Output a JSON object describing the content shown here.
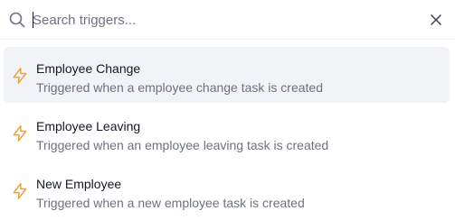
{
  "search": {
    "placeholder": "Search triggers...",
    "value": ""
  },
  "icons": {
    "search": "search-icon",
    "close": "close-icon",
    "trigger": "lightning-bolt-icon"
  },
  "colors": {
    "accent_bolt": "#f0a23c",
    "active_row_bg": "#f1f3f7"
  },
  "triggers": [
    {
      "title": "Employee Change",
      "description": "Triggered when a employee change task is created",
      "active": true
    },
    {
      "title": "Employee Leaving",
      "description": "Triggered when an employee leaving task is created",
      "active": false
    },
    {
      "title": "New Employee",
      "description": "Triggered when a new employee task is created",
      "active": false
    }
  ]
}
